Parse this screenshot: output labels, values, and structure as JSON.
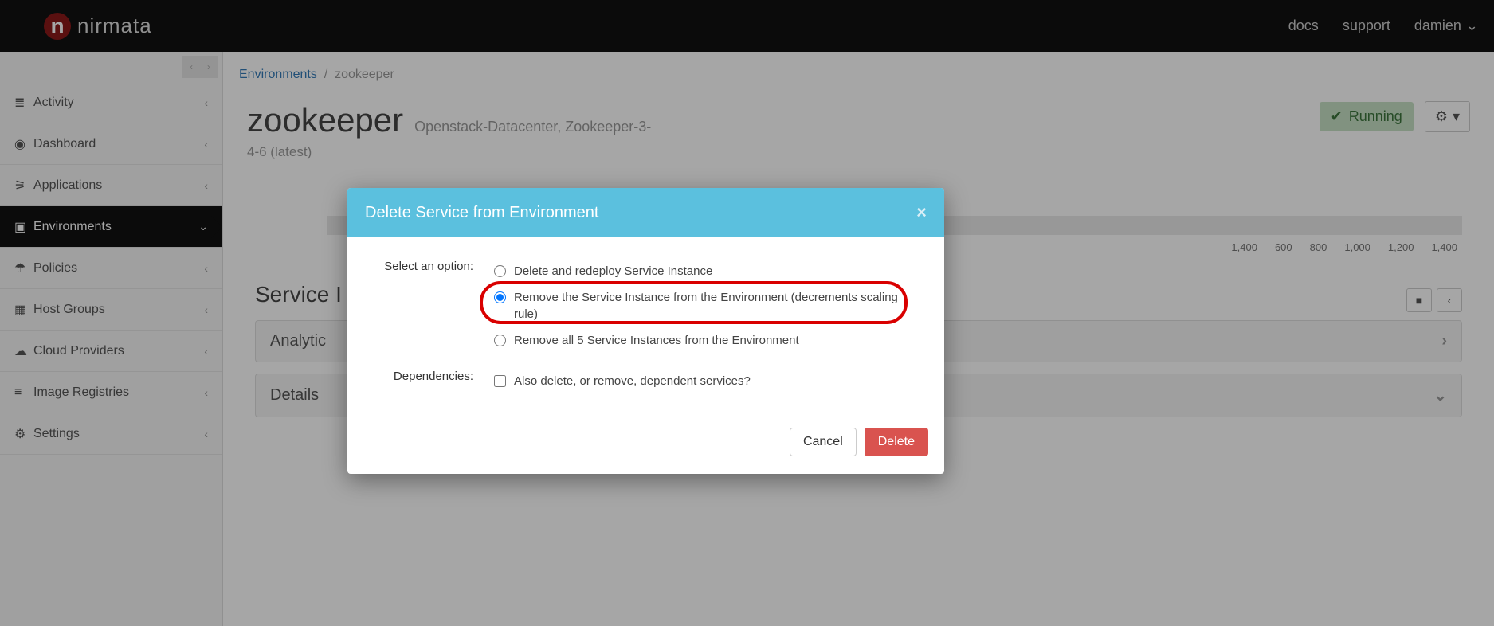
{
  "brand": "nirmata",
  "topnav": {
    "docs": "docs",
    "support": "support",
    "user": "damien"
  },
  "sidebar": {
    "items": [
      {
        "label": "Activity"
      },
      {
        "label": "Dashboard"
      },
      {
        "label": "Applications"
      },
      {
        "label": "Environments"
      },
      {
        "label": "Policies"
      },
      {
        "label": "Host Groups"
      },
      {
        "label": "Cloud Providers"
      },
      {
        "label": "Image Registries"
      },
      {
        "label": "Settings"
      }
    ]
  },
  "breadcrumb": {
    "root": "Environments",
    "current": "zookeeper"
  },
  "page": {
    "title": "zookeeper",
    "subtitle": "Openstack-Datacenter, Zookeeper-3-",
    "version": "4-6 (latest)",
    "status": "Running"
  },
  "chart_data": {
    "type": "bar",
    "categories": [],
    "values": [],
    "title": "",
    "xlabel": "",
    "ylabel": "",
    "ticks_visible": [
      "1,400",
      "600",
      "800",
      "1,000",
      "1,200",
      "1,400"
    ]
  },
  "sections": {
    "service_prefix": "Service I",
    "analytics": "Analytic",
    "details": "Details"
  },
  "modal": {
    "title": "Delete Service from Environment",
    "option_label": "Select an option:",
    "opt1": "Delete and redeploy Service Instance",
    "opt2": "Remove the Service Instance from the Environment (decrements scaling rule)",
    "opt3": "Remove all 5 Service Instances from the Environment",
    "deps_label": "Dependencies:",
    "deps_text": "Also delete, or remove, dependent services?",
    "cancel": "Cancel",
    "delete": "Delete"
  }
}
